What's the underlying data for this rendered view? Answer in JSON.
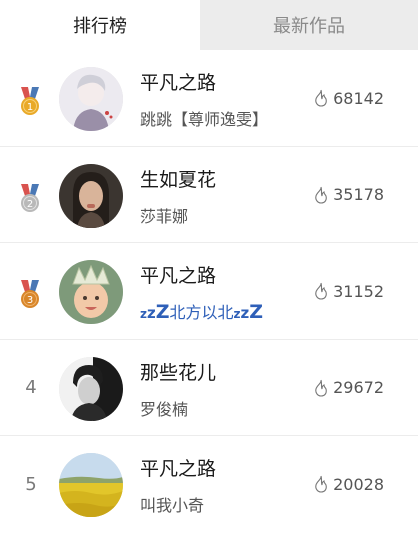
{
  "tabs": [
    {
      "label": "排行榜",
      "active": true
    },
    {
      "label": "最新作品",
      "active": false
    }
  ],
  "rows": [
    {
      "rank": "1",
      "medal": "gold",
      "title": "平凡之路",
      "subtitle": "跳跳【尊师逸雯】",
      "likes": "68142",
      "avatar": "avatar-anime-boy"
    },
    {
      "rank": "2",
      "medal": "silver",
      "title": "生如夏花",
      "subtitle": "莎菲娜",
      "likes": "35178",
      "avatar": "avatar-girl"
    },
    {
      "rank": "3",
      "medal": "bronze",
      "title": "平凡之路",
      "subtitle": "北方以北",
      "likes": "31152",
      "avatar": "avatar-baby-crown"
    },
    {
      "rank": "4",
      "medal": "",
      "title": "那些花儿",
      "subtitle": "罗俊楠",
      "likes": "29672",
      "avatar": "avatar-bw-portrait"
    },
    {
      "rank": "5",
      "medal": "",
      "title": "平凡之路",
      "subtitle": "叫我小奇",
      "likes": "20028",
      "avatar": "avatar-rapeseed-field"
    }
  ],
  "colors": {
    "gold": "#e9a928",
    "silver": "#b9b9b9",
    "bronze": "#d8862a",
    "ribbon_red": "#d9534f",
    "ribbon_blue": "#4a78b5",
    "zz_blue": "#2e5fb8"
  },
  "icons": {
    "likes": "flame-icon",
    "medal": "medal-icon"
  }
}
